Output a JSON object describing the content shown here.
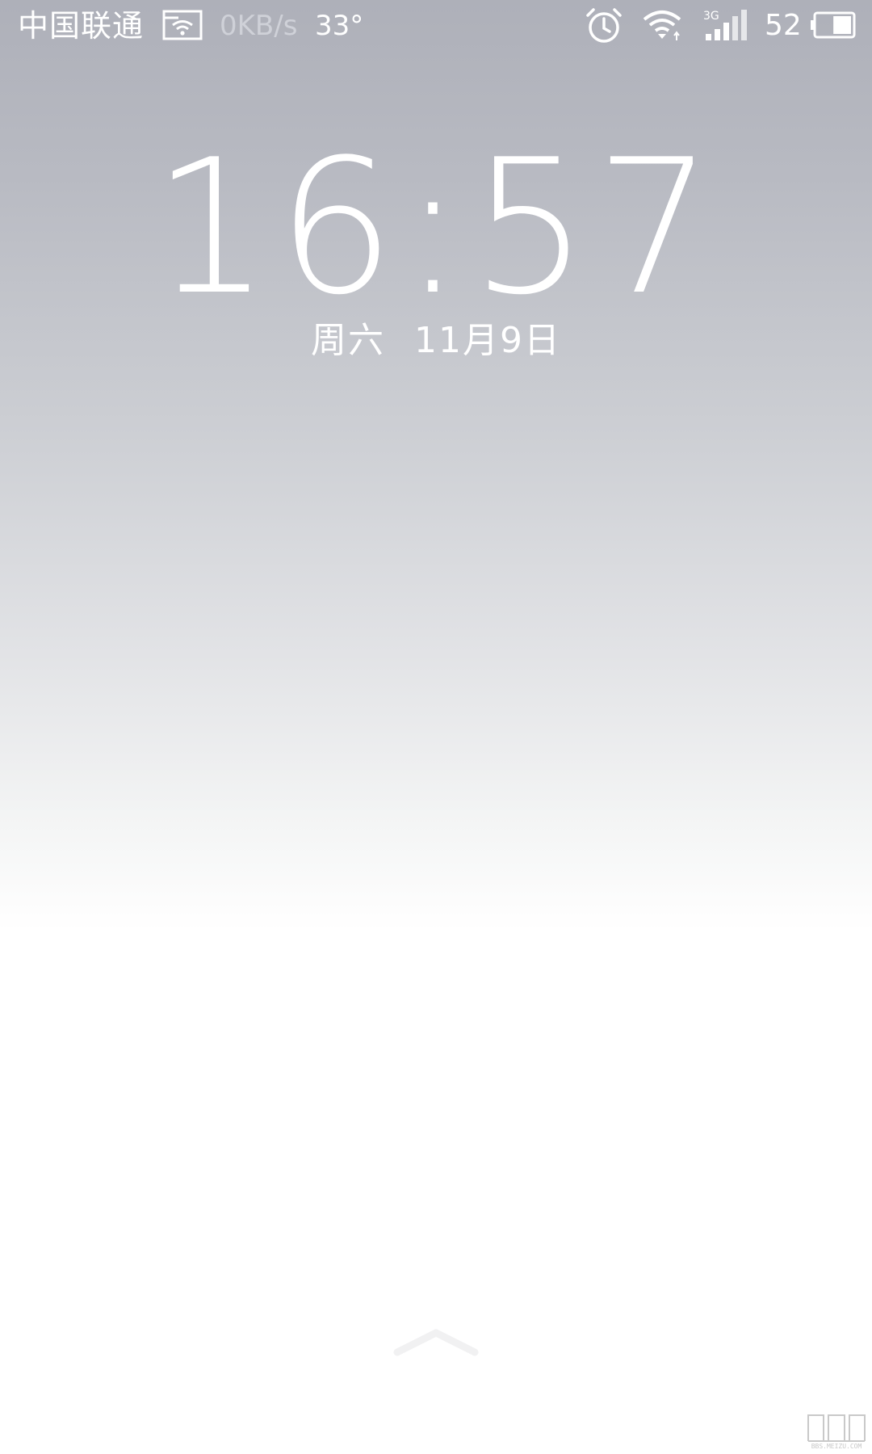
{
  "status_bar": {
    "carrier": "中国联通",
    "network_speed": "0KB/s",
    "temperature": "33°",
    "network_type": "3G",
    "battery_level": "52",
    "battery_fraction": 0.52,
    "icons": [
      "sd-card-wifi-icon",
      "alarm-icon",
      "wifi-icon",
      "signal-icon",
      "battery-icon"
    ]
  },
  "lock_screen": {
    "time": "16:57",
    "weekday": "周六",
    "date": "11月9日"
  },
  "unlock": {
    "icon": "chevron-up-icon"
  },
  "watermark": {
    "text": "BBS.MEIZU.COM"
  },
  "colors": {
    "text": "#ffffff",
    "muted_text": "#cfd1d8",
    "top_background": "#aeb0b9",
    "bottom_background": "#ffffff"
  }
}
